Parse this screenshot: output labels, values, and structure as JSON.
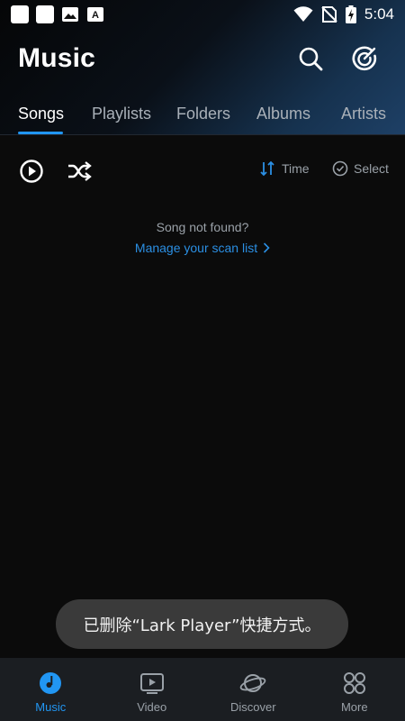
{
  "status_bar": {
    "time": "5:04",
    "battery_icon": "battery-charging-icon",
    "wifi_icon": "wifi-icon",
    "signal_icon": "no-sim-icon"
  },
  "header": {
    "title": "Music"
  },
  "tabs": [
    {
      "label": "Songs",
      "active": true
    },
    {
      "label": "Playlists",
      "active": false
    },
    {
      "label": "Folders",
      "active": false
    },
    {
      "label": "Albums",
      "active": false
    },
    {
      "label": "Artists",
      "active": false
    }
  ],
  "toolbar": {
    "sort_label": "Time",
    "select_label": "Select"
  },
  "empty_state": {
    "message": "Song not found?",
    "link": "Manage your scan list"
  },
  "toast": {
    "text": "已删除“Lark Player”快捷方式。"
  },
  "bottom_nav": [
    {
      "label": "Music",
      "icon": "music-disc-icon",
      "active": true
    },
    {
      "label": "Video",
      "icon": "video-icon",
      "active": false
    },
    {
      "label": "Discover",
      "icon": "planet-icon",
      "active": false
    },
    {
      "label": "More",
      "icon": "more-grid-icon",
      "active": false
    }
  ],
  "colors": {
    "accent": "#2196f3",
    "background": "#0b0b0b",
    "nav_bg": "#1b1e22",
    "link": "#2b8fe3"
  }
}
